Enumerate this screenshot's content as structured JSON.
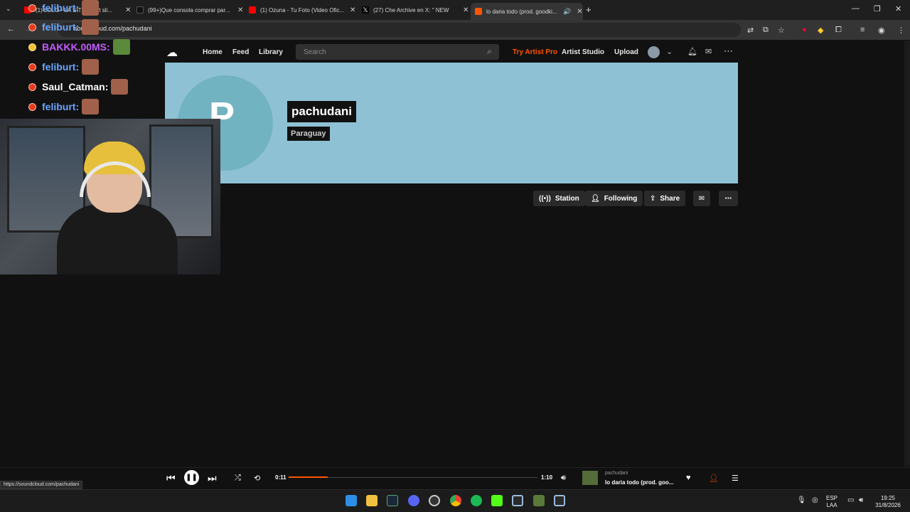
{
  "browser": {
    "tabs": [
      {
        "title": "(1) LOLO - LA SITUA... (ft sli...",
        "favicon": "youtube-icon",
        "color": "#ff0000"
      },
      {
        "title": "(99+)Que consola comprar par...",
        "favicon": "tiktok-icon",
        "color": "#111111"
      },
      {
        "title": "(1) Ozuna - Tu Foto (Video Ofic...",
        "favicon": "youtube-icon",
        "color": "#ff0000"
      },
      {
        "title": "(27) Che Archive en X: \" NEW",
        "favicon": "x-icon",
        "color": "#000000"
      },
      {
        "title": "lo daria todo (prod. goodki...",
        "favicon": "soundcloud-icon",
        "color": "#ff5500",
        "active": true
      }
    ],
    "url": "soundcloud.com/pachudani",
    "status_url": "https://soundcloud.com/pachudani"
  },
  "stream_overlay": {
    "chat": [
      {
        "user": "feliburt:",
        "color": "#6aa6ff"
      },
      {
        "user": "feliburt:",
        "color": "#6aa6ff"
      },
      {
        "user": "BAKKK.00MS:",
        "color": "#c45cff"
      },
      {
        "user": "feliburt:",
        "color": "#6aa6ff"
      },
      {
        "user": "Saul_Catman:",
        "color": "#ffffff"
      },
      {
        "user": "feliburt:",
        "color": "#6aa6ff"
      }
    ]
  },
  "soundcloud": {
    "nav": {
      "home": "Home",
      "feed": "Feed",
      "library": "Library"
    },
    "search_placeholder": "Search",
    "try_artist_pro": "Try Artist Pro",
    "artist_studio": "Artist Studio",
    "upload": "Upload",
    "accent": "#ff5500",
    "profile": {
      "avatar_letter": "P",
      "username": "pachudani",
      "country": "Paraguay",
      "banner_color": "#8fc1d4"
    },
    "actions": {
      "station": "Station",
      "following": "Following",
      "share": "Share"
    }
  },
  "player": {
    "elapsed": "0:11",
    "duration": "1:10",
    "progress": 0.157,
    "track_artist": "pachudani",
    "track_title": "lo daria todo (prod. goo..."
  },
  "taskbar": {
    "lang_top": "ESP",
    "lang_bottom": "LAA",
    "time": "19:25",
    "date": "31/8/2026"
  }
}
